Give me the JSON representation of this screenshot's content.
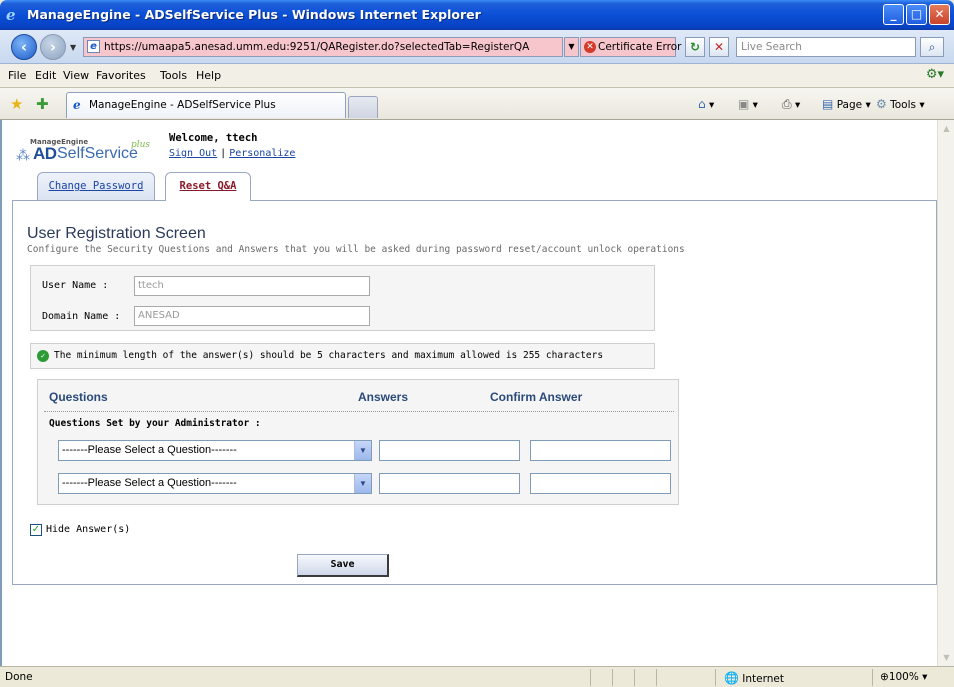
{
  "window": {
    "title": "ManageEngine - ADSelfService Plus - Windows Internet Explorer"
  },
  "address_bar": {
    "url": "https://umaapa5.anesad.umm.edu:9251/QARegister.do?selectedTab=RegisterQA",
    "cert_error": "Certificate Error",
    "search_placeholder": "Live Search"
  },
  "menu": {
    "items": [
      "File",
      "Edit",
      "View",
      "Favorites",
      "Tools",
      "Help"
    ]
  },
  "browser_tab": {
    "label": "ManageEngine - ADSelfService Plus"
  },
  "command_bar": {
    "page": "Page",
    "tools": "Tools"
  },
  "app": {
    "logo_vendor": "ManageEngine",
    "logo_ad": "AD",
    "logo_product": "SelfService",
    "logo_plus": "plus",
    "welcome": "Welcome, ttech",
    "sign_out": "Sign Out",
    "separator": "|",
    "personalize": "Personalize",
    "tabs": [
      "Change Password",
      "Reset Q&A"
    ],
    "title": "User Registration Screen",
    "subtitle": "Configure the Security Questions and Answers that you will be asked during password reset/account unlock operations",
    "user_name_label": "User Name :",
    "user_name_value": "ttech",
    "domain_name_label": "Domain Name :",
    "domain_name_value": "ANESAD",
    "info": "The minimum length of the answer(s) should be 5 characters and maximum allowed is 255 characters",
    "col_questions": "Questions",
    "col_answers": "Answers",
    "col_confirm": "Confirm Answer",
    "admin_set": "Questions Set by your Administrator :",
    "question_placeholder": "-------Please Select a Question-------",
    "hide_answers": "Hide Answer(s)",
    "save": "Save"
  },
  "status_bar": {
    "text": "Done",
    "zone": "Internet",
    "zoom": "100%"
  },
  "colors": {
    "title_bar": "#0a4fd6",
    "link": "#1b45a6",
    "active_tab_text": "#8a1a2a",
    "url_error_bg": "#f7c6cc"
  }
}
